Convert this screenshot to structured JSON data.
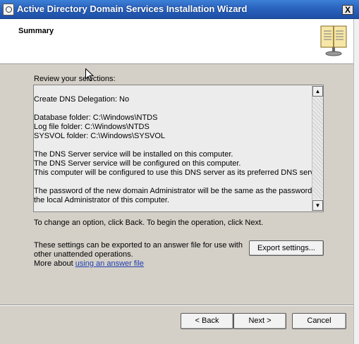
{
  "window": {
    "title": "Active Directory Domain Services Installation Wizard",
    "close_label": "X"
  },
  "header": {
    "title": "Summary",
    "icon": "book-icon"
  },
  "review_label": "Review your selections:",
  "summary_lines": [
    "Create DNS Delegation: No",
    "",
    "Database folder: C:\\Windows\\NTDS",
    "Log file folder: C:\\Windows\\NTDS",
    "SYSVOL folder: C:\\Windows\\SYSVOL",
    "",
    "The DNS Server service will be installed on this computer.",
    "The DNS Server service will be configured on this computer.",
    "This computer will be configured to use this DNS server as its preferred DNS server.",
    "",
    "The password of the new domain Administrator will be the same as the password of",
    "the local Administrator of this computer."
  ],
  "scrollbar": {
    "up_arrow": "▲",
    "down_arrow": "▼"
  },
  "change_text": "To change an option, click Back. To begin the operation, click Next.",
  "export": {
    "text": "These settings can be exported to an answer file for use with other unattended operations.",
    "button_label": "Export settings..."
  },
  "more_about": {
    "prefix": "More about ",
    "link_text": "using an answer file"
  },
  "buttons": {
    "back": "< Back",
    "next": "Next >",
    "cancel": "Cancel"
  }
}
